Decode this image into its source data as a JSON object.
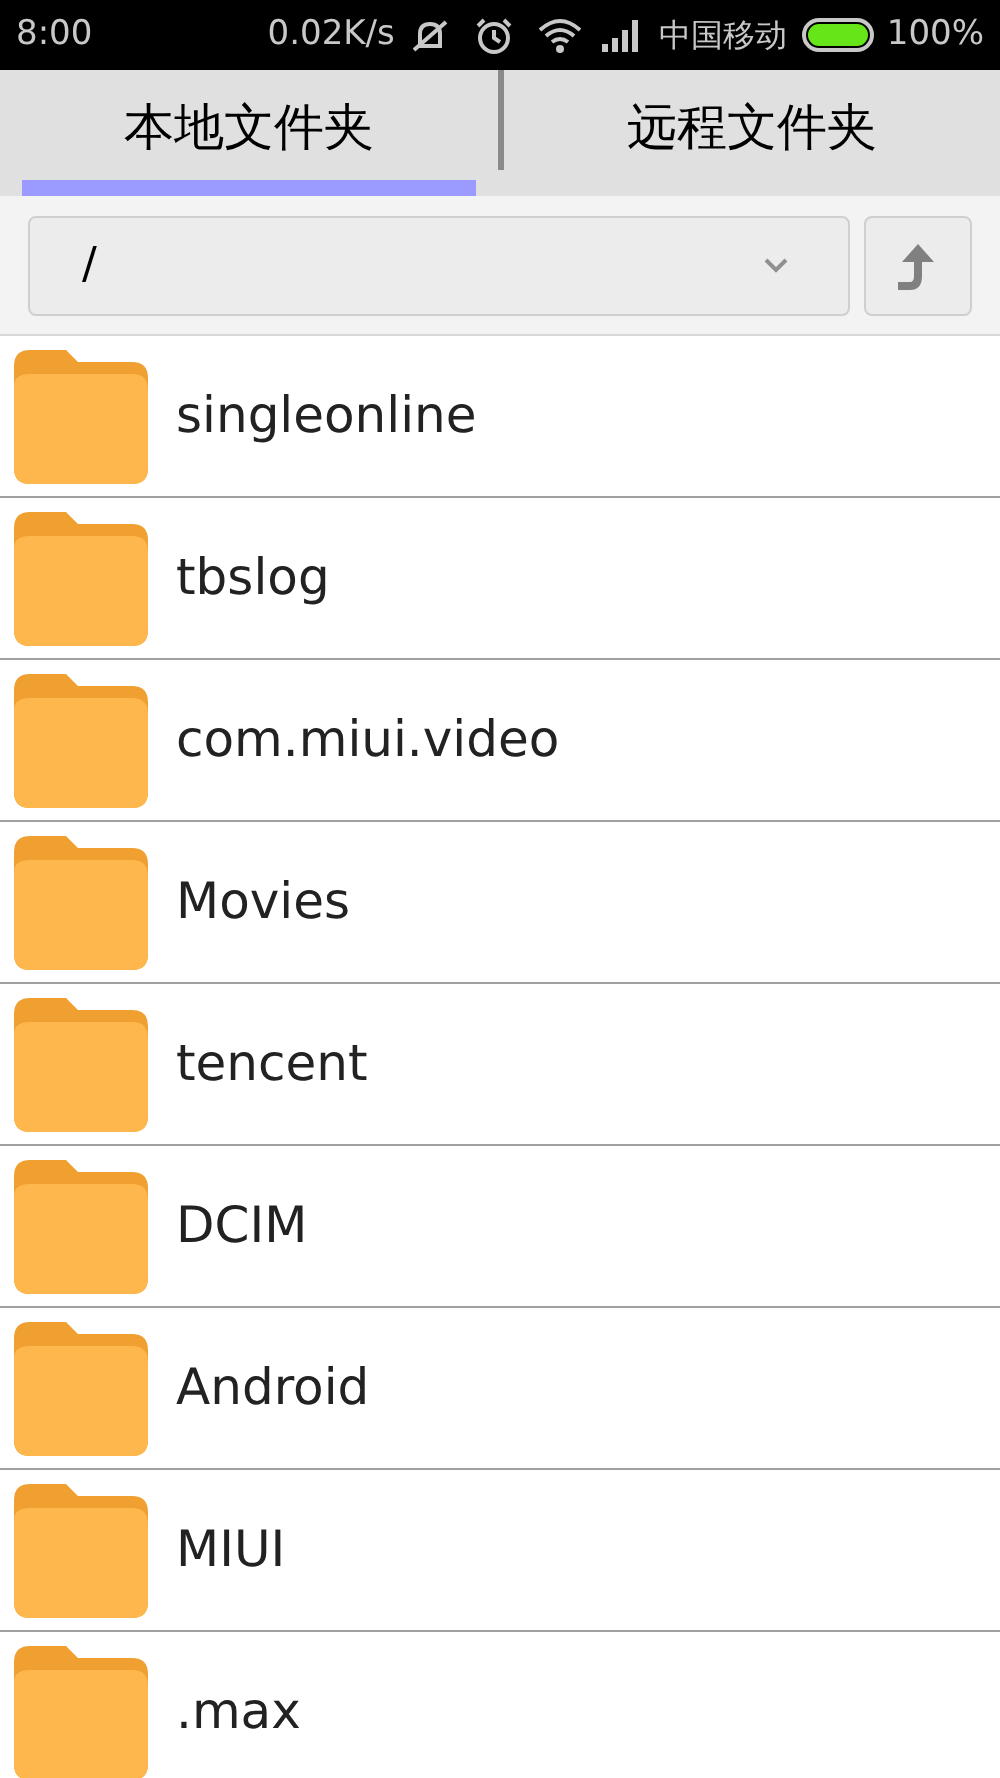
{
  "status_bar": {
    "time": "8:00",
    "net_speed": "0.02K/s",
    "carrier": "中国移动",
    "battery": "100%"
  },
  "tabs": [
    {
      "label": "本地文件夹",
      "selected": true
    },
    {
      "label": "远程文件夹",
      "selected": false
    }
  ],
  "path": {
    "value": "/"
  },
  "files": [
    {
      "name": "singleonline"
    },
    {
      "name": "tbslog"
    },
    {
      "name": "com.miui.video"
    },
    {
      "name": "Movies"
    },
    {
      "name": "tencent"
    },
    {
      "name": "DCIM"
    },
    {
      "name": "Android"
    },
    {
      "name": "MIUI"
    },
    {
      "name": ".max"
    }
  ]
}
